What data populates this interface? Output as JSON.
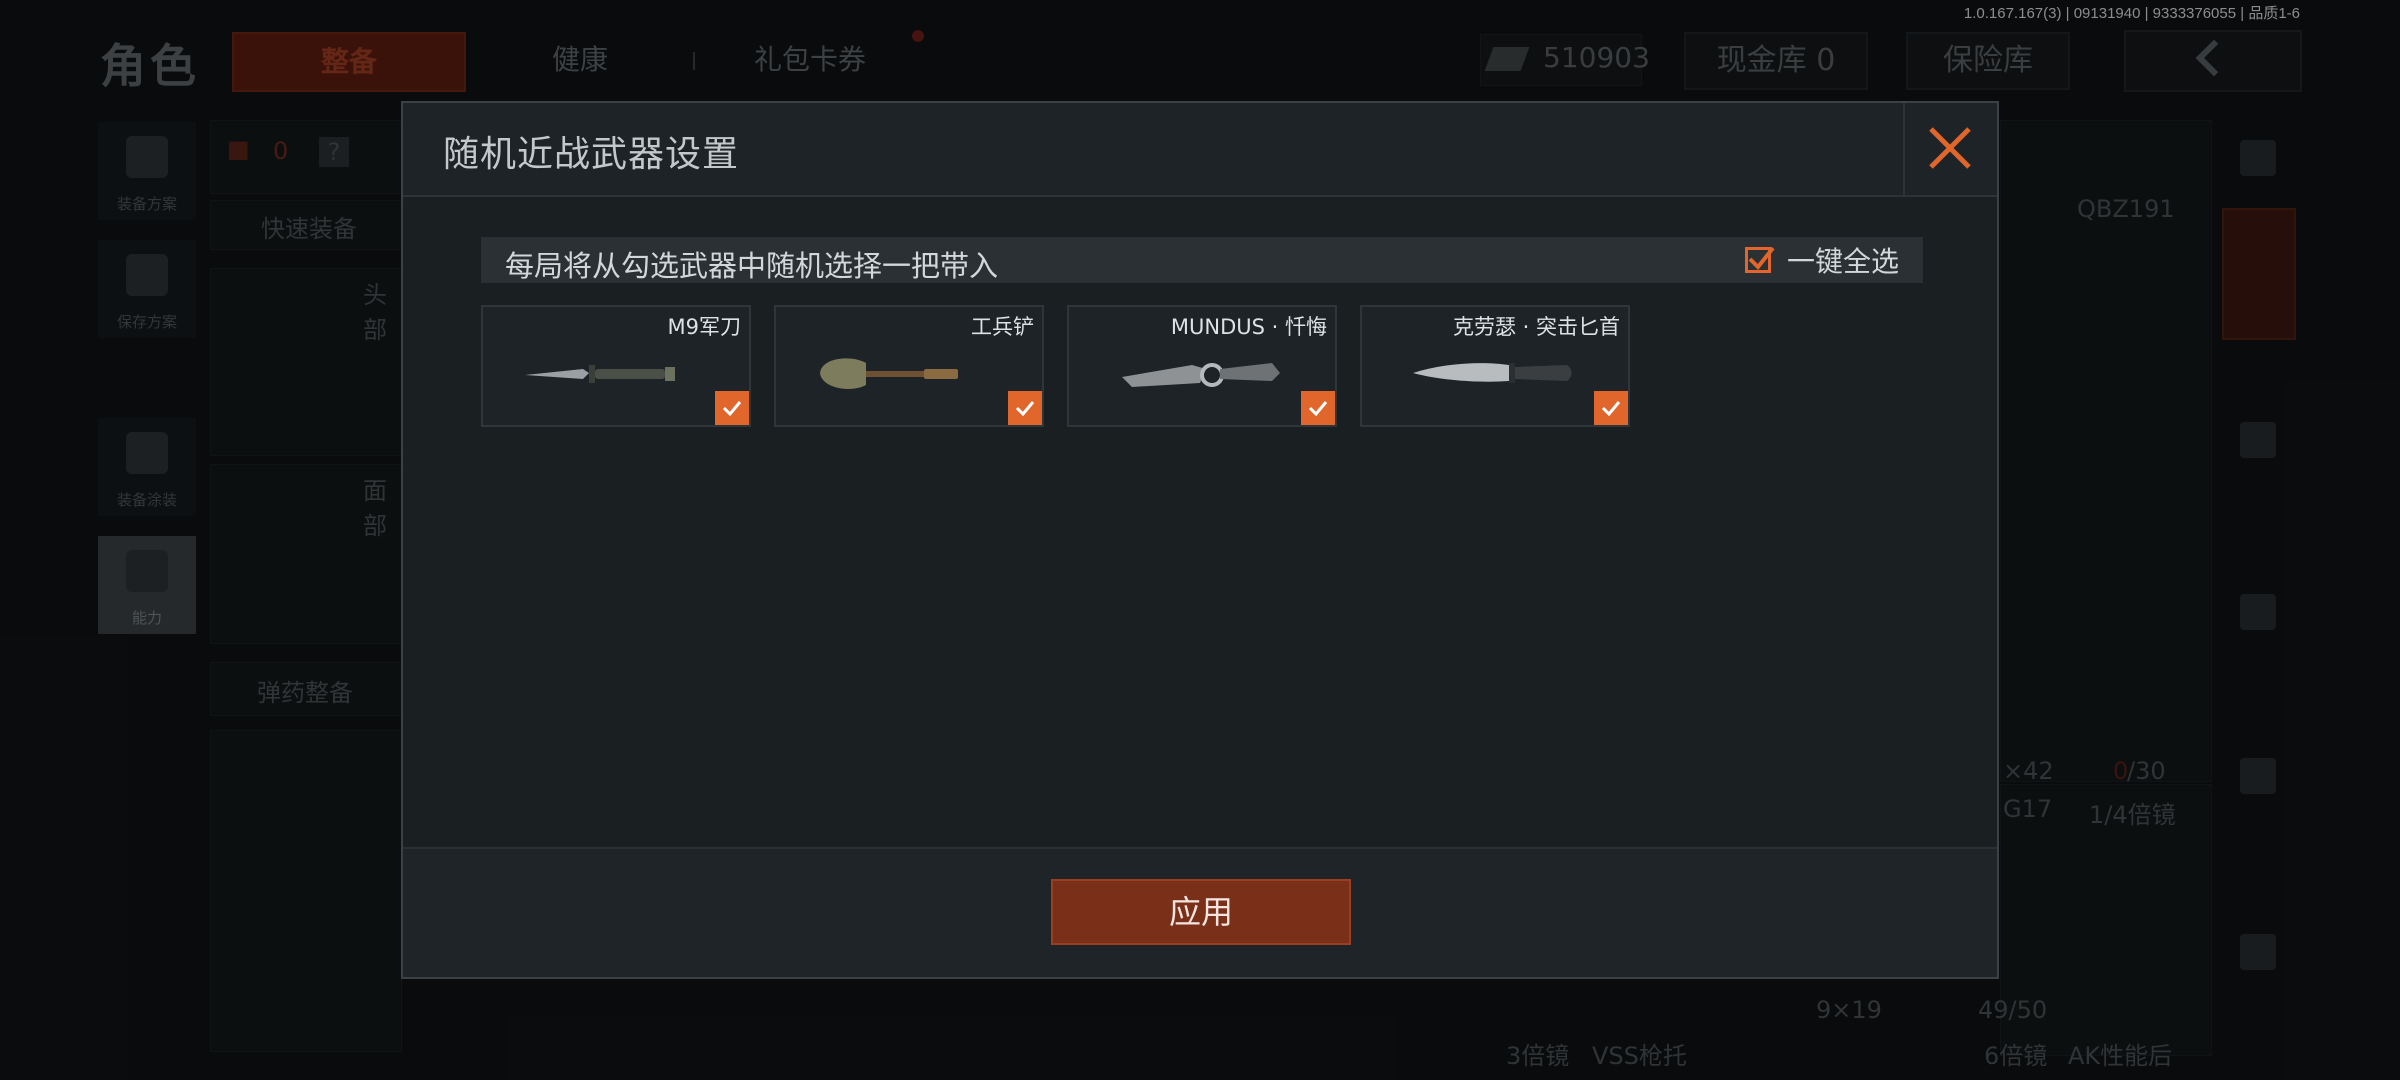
{
  "version": "1.0.167.167(3) | 09131940 | 9333376055 | 品质1-6",
  "header": {
    "title": "角色",
    "tabs": [
      "整备",
      "健康",
      "礼包卡券"
    ],
    "money": "510903",
    "cash_vault": "现金库 0",
    "insurance": "保险库"
  },
  "sidebar": [
    "装备方案",
    "保存方案",
    "装备涂装",
    "能力"
  ],
  "background": {
    "quick_equip": "快速装备",
    "head_label": "头部",
    "face_label": "面部",
    "ammo_equip": "弹药整备",
    "red_count": "0",
    "help": "?",
    "weapon_name": "QBZ191",
    "x42": "×42",
    "ammo_count_red": "0",
    "ammo_total": "/30",
    "g17": "G17",
    "scope_1_4": "1/4倍镜",
    "caliber": "9×19",
    "mag": "49/50",
    "scope_3": "3倍镜",
    "vss": "VSS枪托",
    "scope_6": "6倍镜",
    "ak": "AK性能后"
  },
  "modal": {
    "title": "随机近战武器设置",
    "info_text": "每局将从勾选武器中随机选择一把带入",
    "select_all_label": "一键全选",
    "weapons": [
      {
        "name": "M9军刀",
        "checked": true
      },
      {
        "name": "工兵铲",
        "checked": true
      },
      {
        "name": "MUNDUS · 忏悔",
        "checked": true
      },
      {
        "name": "克劳瑟 · 突击匕首",
        "checked": true
      }
    ],
    "apply_label": "应用"
  },
  "colors": {
    "accent": "#e0662c",
    "apply_bg": "#7a2f18"
  }
}
